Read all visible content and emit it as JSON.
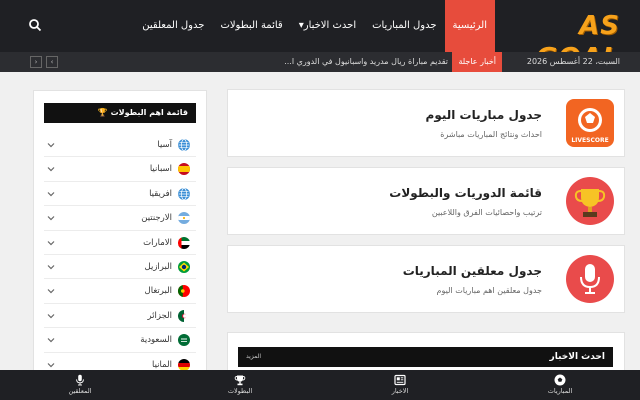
{
  "header": {
    "logo": "AS GOAL",
    "nav": [
      "الرئيسية",
      "جدول المباريات",
      "احدث الاخبار",
      "قائمة البطولات",
      "جدول المعلقين"
    ],
    "nav_dropdown_indicator": "▾"
  },
  "ticker": {
    "date": "السبت، 22 أغسطس 2026",
    "badge": "أخبار عاجلة",
    "headline": "تقديم مباراة ريال مدريد واسبانيول في الدوري ا...",
    "prev": "‹",
    "next": "›"
  },
  "cards": [
    {
      "title": "جدول مباريات اليوم",
      "subtitle": "احداث ونتائج المباريات مباشرة",
      "icon": "livescore-icon",
      "icon_text": "LIVESCORE",
      "color": "#f26522"
    },
    {
      "title": "قائمة الدوريات والبطولات",
      "subtitle": "ترتيب واحصائيات الفرق واللاعبين",
      "icon": "trophy-icon",
      "color": "#e94b4b"
    },
    {
      "title": "جدول معلقين المباريات",
      "subtitle": "جدول معلقين اهم مباريات اليوم",
      "icon": "microphone-icon",
      "color": "#e94b4b"
    }
  ],
  "news": {
    "title": "احدث الاخبار",
    "more": "المزيد"
  },
  "sidebar": {
    "title": "قائمة اهم البطولات 🏆",
    "items": [
      {
        "label": "آسيا",
        "flag": "globe"
      },
      {
        "label": "اسبانيا",
        "flag": "spain"
      },
      {
        "label": "افريقيا",
        "flag": "globe"
      },
      {
        "label": "الارجنتين",
        "flag": "argentina"
      },
      {
        "label": "الامارات",
        "flag": "uae"
      },
      {
        "label": "البرازيل",
        "flag": "brazil"
      },
      {
        "label": "البرتغال",
        "flag": "portugal"
      },
      {
        "label": "الجزائر",
        "flag": "algeria"
      },
      {
        "label": "السعودية",
        "flag": "saudi"
      },
      {
        "label": "المانيا",
        "flag": "germany"
      }
    ]
  },
  "bottom_nav": [
    {
      "label": "المباريات",
      "icon": "soccer-ball-icon"
    },
    {
      "label": "الاخبار",
      "icon": "newspaper-icon"
    },
    {
      "label": "البطولات",
      "icon": "trophy-icon"
    },
    {
      "label": "المعلقين",
      "icon": "microphone-icon"
    }
  ],
  "colors": {
    "accent": "#e74c3c",
    "dark": "#1f2024",
    "logo": "#f7a21b"
  }
}
